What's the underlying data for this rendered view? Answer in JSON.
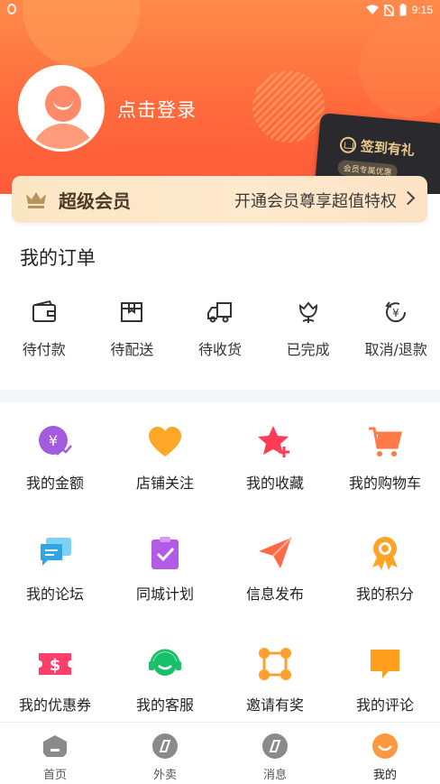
{
  "status_bar": {
    "time": "9:15"
  },
  "header": {
    "login_text": "点击登录",
    "signin_card": {
      "title": "签到有礼",
      "subtitle": "会员专属优惠"
    }
  },
  "vip": {
    "title": "超级会员",
    "promo": "开通会员尊享超值特权"
  },
  "orders": {
    "title": "我的订单",
    "items": [
      {
        "label": "待付款",
        "icon": "wallet-icon"
      },
      {
        "label": "待配送",
        "icon": "package-icon"
      },
      {
        "label": "待收货",
        "icon": "truck-icon"
      },
      {
        "label": "已完成",
        "icon": "flower-icon"
      },
      {
        "label": "取消/退款",
        "icon": "refund-icon"
      }
    ]
  },
  "services": [
    {
      "label": "我的金额",
      "icon": "money-icon",
      "color": "#a35ce0"
    },
    {
      "label": "店铺关注",
      "icon": "heart-icon",
      "color": "#ffa726"
    },
    {
      "label": "我的收藏",
      "icon": "star-icon",
      "color": "#ff3b55"
    },
    {
      "label": "我的购物车",
      "icon": "cart-icon",
      "color": "#ff7a45"
    },
    {
      "label": "我的论坛",
      "icon": "chat-icon",
      "color": "#2ea6e8"
    },
    {
      "label": "同城计划",
      "icon": "clipboard-icon",
      "color": "#b45ae8"
    },
    {
      "label": "信息发布",
      "icon": "send-icon",
      "color": "#ff6a45"
    },
    {
      "label": "我的积分",
      "icon": "medal-icon",
      "color": "#ffa424"
    },
    {
      "label": "我的优惠券",
      "icon": "coupon-icon",
      "color": "#ff3e6a"
    },
    {
      "label": "我的客服",
      "icon": "headset-icon",
      "color": "#19c06a"
    },
    {
      "label": "邀请有奖",
      "icon": "network-icon",
      "color": "#ff9f2e"
    },
    {
      "label": "我的评论",
      "icon": "comment-icon",
      "color": "#ff9f1c"
    }
  ],
  "tabbar": [
    {
      "label": "首页",
      "icon": "home-icon"
    },
    {
      "label": "外卖",
      "icon": "takeout-icon"
    },
    {
      "label": "消息",
      "icon": "message-icon"
    },
    {
      "label": "我的",
      "icon": "profile-icon",
      "active": true
    }
  ]
}
